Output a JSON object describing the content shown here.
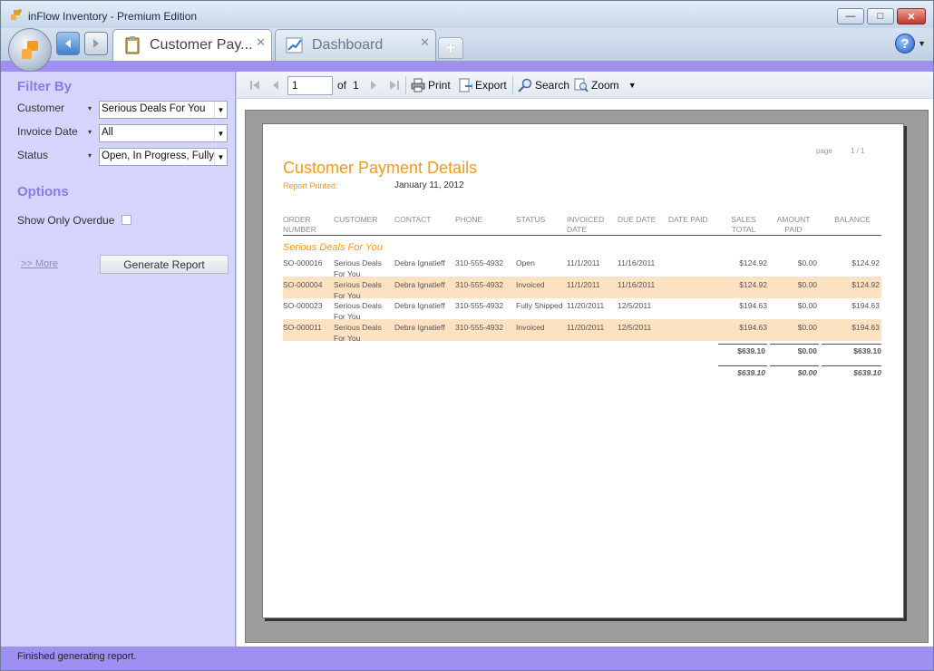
{
  "window": {
    "title": "inFlow Inventory - Premium Edition",
    "min": "—",
    "max": "□",
    "close": "✕"
  },
  "tabs": [
    {
      "label": "Customer Pay...",
      "close": "✕"
    },
    {
      "label": "Dashboard",
      "close": "✕"
    }
  ],
  "tab_add": "+",
  "help": {
    "label": "?",
    "dropdown": "▼"
  },
  "sidebar": {
    "filter_title": "Filter By",
    "filters": [
      {
        "label": "Customer",
        "value": "Serious Deals For You"
      },
      {
        "label": "Invoice Date",
        "value": "All"
      },
      {
        "label": "Status",
        "value": "Open, In Progress, Fully S"
      }
    ],
    "options_title": "Options",
    "overdue_label": "Show Only Overdue",
    "more_link": ">> More",
    "generate_button": "Generate Report"
  },
  "toolbar": {
    "page_value": "1",
    "of_label": "of",
    "total_pages": "1",
    "print": "Print",
    "export": "Export",
    "search": "Search",
    "zoom": "Zoom"
  },
  "report": {
    "title": "Customer Payment Details",
    "printed_label": "Report Printed:",
    "printed_value": "January 11, 2012",
    "page_label": "page",
    "page_value": "1 / 1",
    "columns": [
      "ORDER NUMBER",
      "CUSTOMER",
      "CONTACT",
      "PHONE",
      "STATUS",
      "INVOICED DATE",
      "DUE DATE",
      "DATE PAID",
      "SALES TOTAL",
      "AMOUNT PAID",
      "BALANCE"
    ],
    "group": "Serious Deals For You",
    "rows": [
      {
        "order": "SO-000016",
        "customer": "Serious Deals For You",
        "contact": "Debra Ignatieff",
        "phone": "310-555-4932",
        "status": "Open",
        "invoiced": "11/1/2011",
        "due": "11/16/2011",
        "paid_date": "",
        "sales": "$124.92",
        "amount": "$0.00",
        "balance": "$124.92"
      },
      {
        "order": "SO-000004",
        "customer": "Serious Deals For You",
        "contact": "Debra Ignatieff",
        "phone": "310-555-4932",
        "status": "Invoiced",
        "invoiced": "11/1/2011",
        "due": "11/16/2011",
        "paid_date": "",
        "sales": "$124.92",
        "amount": "$0.00",
        "balance": "$124.92"
      },
      {
        "order": "SO-000023",
        "customer": "Serious Deals For You",
        "contact": "Debra Ignatieff",
        "phone": "310-555-4932",
        "status": "Fully Shipped",
        "invoiced": "11/20/2011",
        "due": "12/5/2011",
        "paid_date": "",
        "sales": "$194.63",
        "amount": "$0.00",
        "balance": "$194.63"
      },
      {
        "order": "SO-000011",
        "customer": "Serious Deals For You",
        "contact": "Debra Ignatieff",
        "phone": "310-555-4932",
        "status": "Invoiced",
        "invoiced": "11/20/2011",
        "due": "12/5/2011",
        "paid_date": "",
        "sales": "$194.63",
        "amount": "$0.00",
        "balance": "$194.63"
      }
    ],
    "group_totals": {
      "sales": "$639.10",
      "amount": "$0.00",
      "balance": "$639.10"
    },
    "grand_totals": {
      "sales": "$639.10",
      "amount": "$0.00",
      "balance": "$639.10"
    }
  },
  "status": "Finished generating report.",
  "colors": {
    "accent": "#9f8ff0",
    "sidebar": "#d4d4fc",
    "report_orange": "#f39a1c",
    "alt_row": "#fde2c2"
  }
}
